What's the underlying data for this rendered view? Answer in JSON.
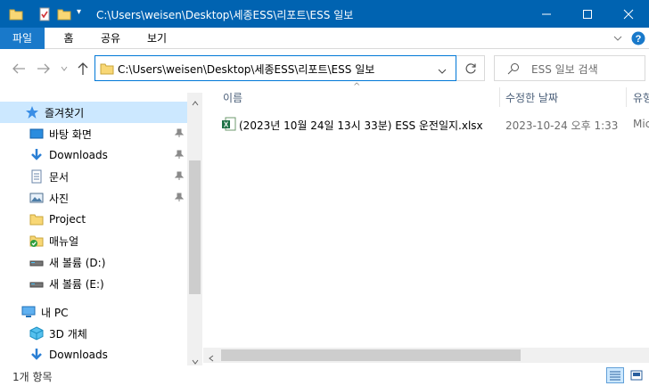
{
  "window": {
    "title": "C:\\Users\\weisen\\Desktop\\세종ESS\\리포트\\ESS 일보",
    "minimize_label": "—",
    "maximize_label": "☐",
    "close_label": "✕",
    "accent": "#0063b1"
  },
  "ribbon": {
    "tabs": [
      {
        "label": "파일"
      },
      {
        "label": "홈"
      },
      {
        "label": "공유"
      },
      {
        "label": "보기"
      }
    ],
    "expand_label": "⌄",
    "help_label": "?"
  },
  "address": {
    "back_label": "←",
    "forward_label": "→",
    "recent_label": "⌄",
    "up_label": "↑",
    "path": "C:\\Users\\weisen\\Desktop\\세종ESS\\리포트\\ESS 일보",
    "dropdown_label": "⌄",
    "refresh_label": "↻",
    "search_placeholder": "ESS 일보 검색"
  },
  "sidebar": {
    "quick_access": "즐겨찾기",
    "items": [
      {
        "label": "바탕 화면",
        "icon": "desktop-icon",
        "pinned": true
      },
      {
        "label": "Downloads",
        "icon": "download-icon",
        "pinned": true
      },
      {
        "label": "문서",
        "icon": "document-icon",
        "pinned": true
      },
      {
        "label": "사진",
        "icon": "picture-icon",
        "pinned": true
      },
      {
        "label": "Project",
        "icon": "folder-icon",
        "pinned": false
      },
      {
        "label": "매뉴얼",
        "icon": "folder-sync-icon",
        "pinned": false
      },
      {
        "label": "새 볼륨 (D:)",
        "icon": "drive-icon",
        "pinned": false
      },
      {
        "label": "새 볼륨 (E:)",
        "icon": "drive-icon",
        "pinned": false
      }
    ],
    "this_pc": "내 PC",
    "pc_items": [
      {
        "label": "3D 개체",
        "icon": "3d-objects-icon"
      },
      {
        "label": "Downloads",
        "icon": "download-icon"
      }
    ]
  },
  "list": {
    "columns": [
      "이름",
      "수정한 날짜",
      "유형"
    ],
    "sort_indicator": "^",
    "files": [
      {
        "name": "(2023년 10월 24일 13시 33분) ESS 운전일지.xlsx",
        "modified": "2023-10-24 오후 1:33",
        "type": "Mic"
      }
    ]
  },
  "status": {
    "item_count": "1개 항목"
  }
}
